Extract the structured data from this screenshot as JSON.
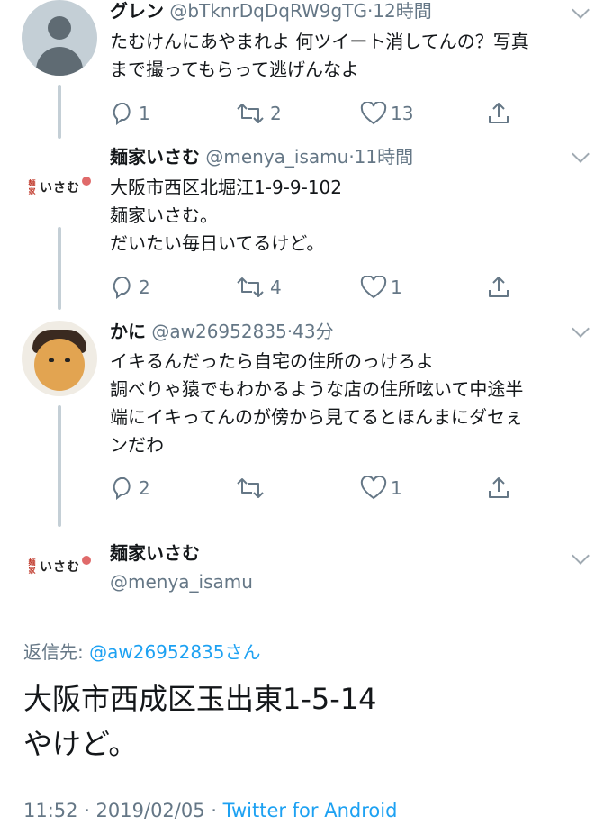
{
  "tweets": [
    {
      "name": "グレン",
      "handle": "@bTknrDqDqRW9gTG",
      "time": "·12時間",
      "lines": [
        "たむけんにあやまれよ 何ツイート消してんの？写真",
        "まで撮ってもらって逃げんなよ"
      ],
      "replies": "1",
      "retweets": "2",
      "likes": "13"
    },
    {
      "name": "麺家いさむ",
      "handle": "@menya_isamu",
      "time": "·11時間",
      "lines": [
        "大阪市西区北堀江1-9-9-102",
        "麺家いさむ。",
        "だいたい毎日いてるけど。"
      ],
      "replies": "2",
      "retweets": "4",
      "likes": "1"
    },
    {
      "name": "かに",
      "handle": "@aw26952835",
      "time": "·43分",
      "lines": [
        "イキるんだったら自宅の住所のっけろよ",
        "調べりゃ猿でもわかるような店の住所呟いて中途半",
        "端にイキってんのが傍から見てるとほんまにダセぇ",
        "ンだわ"
      ],
      "replies": "2",
      "retweets": "",
      "likes": "1"
    }
  ],
  "main_tweet": {
    "name": "麺家いさむ",
    "handle": "@menya_isamu",
    "reply_prefix": "返信先: ",
    "reply_handle": "@aw26952835さん",
    "line1": "大阪市西成区玉出東1-5-14",
    "line2": "やけど。",
    "timestamp": "11:52 · 2019/02/05 · ",
    "source": "Twitter for Android"
  },
  "logo_text": "いさむ",
  "logo_small": "麺家",
  "colors": {
    "accent": "#1da1f2",
    "muted": "#657786",
    "text": "#14171a",
    "line": "#c4cfd6"
  },
  "icons": [
    "reply-icon",
    "retweet-icon",
    "like-icon",
    "share-icon",
    "chevron-down-icon"
  ]
}
